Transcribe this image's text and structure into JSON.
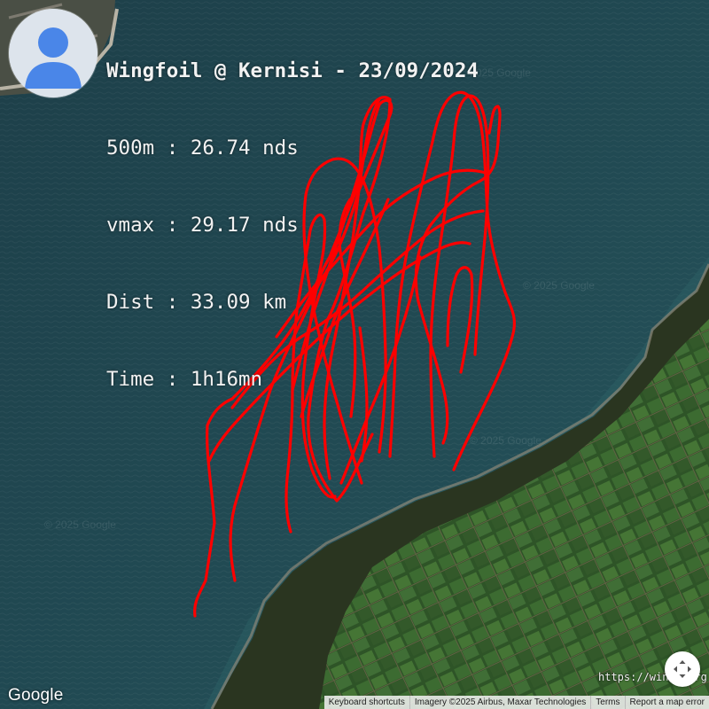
{
  "ride": {
    "title": "Wingfoil @ Kernisi - 23/09/2024",
    "best_500m": "500m : 26.74 nds",
    "vmax": "vmax : 29.17 nds",
    "distance": "Dist : 33.09 km",
    "duration": "Time : 1h16mn",
    "track_color": "#ff0000"
  },
  "map": {
    "provider_logo": "Google",
    "website": "https://windr.org",
    "watermark": "© 2025 Google",
    "water_color": "#1f4650",
    "land_color": "#2c3a22",
    "field_color": "#3c6a30"
  },
  "footer": {
    "keyboard_shortcuts": "Keyboard shortcuts",
    "imagery": "Imagery ©2025 Airbus, Maxar Technologies",
    "terms": "Terms",
    "report": "Report a map error"
  },
  "icons": {
    "avatar": "person-silhouette-icon",
    "recenter": "four-arrows-icon"
  }
}
